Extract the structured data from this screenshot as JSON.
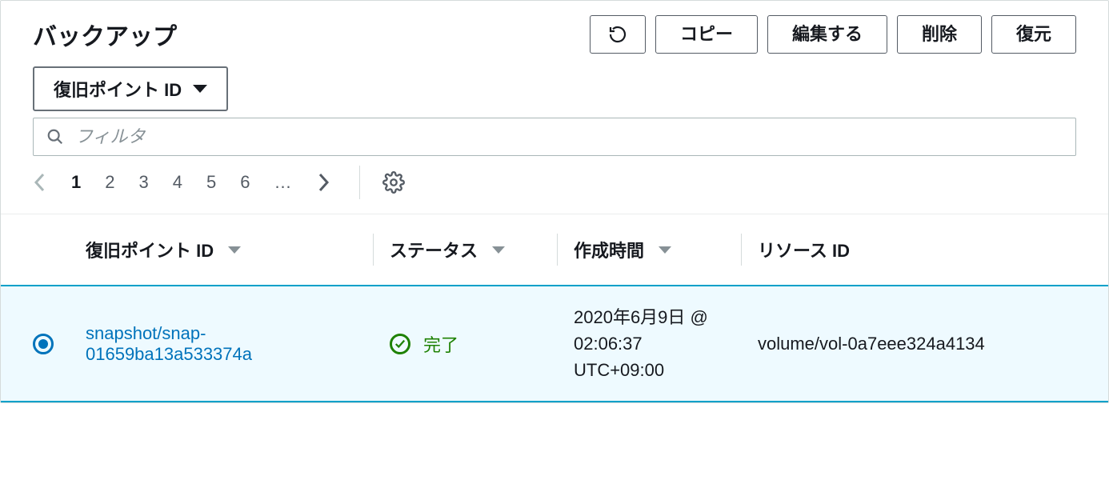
{
  "header": {
    "title": "バックアップ",
    "actions": {
      "copy": "コピー",
      "edit": "編集する",
      "delete": "削除",
      "restore": "復元"
    }
  },
  "filter": {
    "dropdown_label": "復旧ポイント ID",
    "search_placeholder": "フィルタ"
  },
  "pagination": {
    "pages": [
      "1",
      "2",
      "3",
      "4",
      "5",
      "6"
    ],
    "ellipsis": "…",
    "current": "1"
  },
  "columns": {
    "recovery_point_id": "復旧ポイント ID",
    "status": "ステータス",
    "created_at": "作成時間",
    "resource_id": "リソース ID"
  },
  "rows": [
    {
      "selected": true,
      "recovery_point_id": "snapshot/snap-01659ba13a533374a",
      "status_label": "完了",
      "created_at": "2020年6月9日 @ 02:06:37 UTC+09:00",
      "resource_id": "volume/vol-0a7eee324a4134"
    }
  ]
}
